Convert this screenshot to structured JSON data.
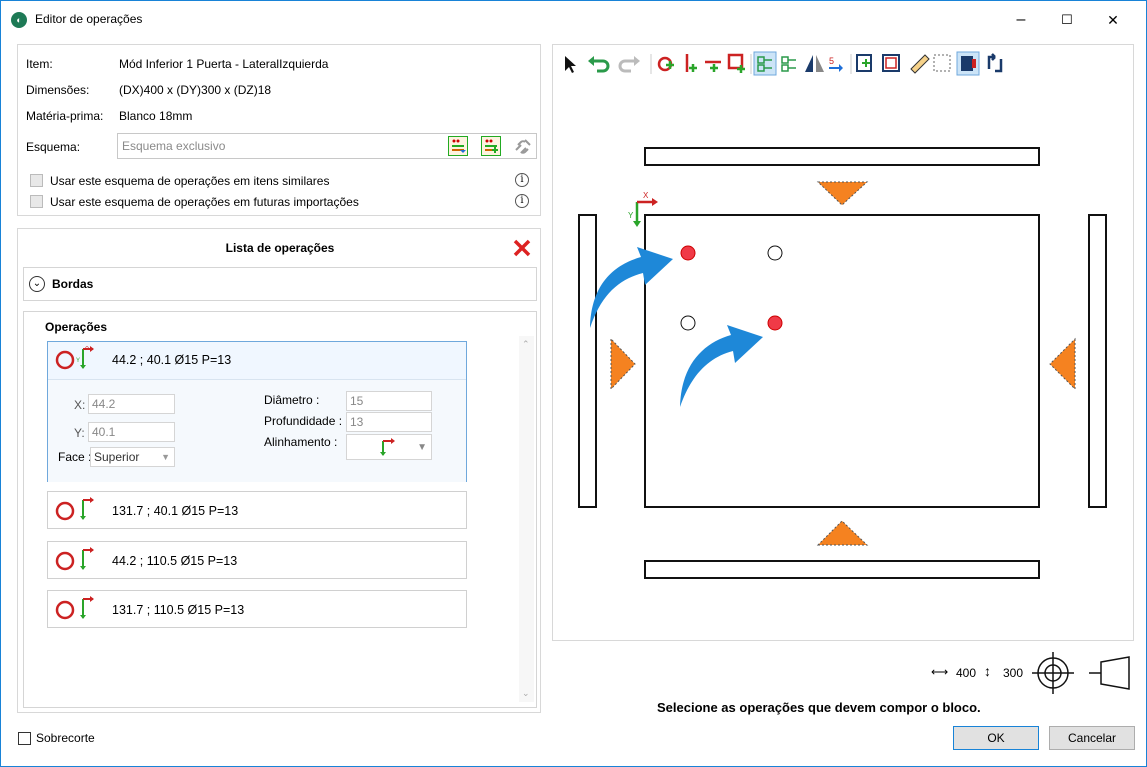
{
  "window": {
    "title": "Editor de operações",
    "minimize": "–",
    "maximize": "☐",
    "close": "✕"
  },
  "item": {
    "item_label": "Item:",
    "item_value": "Mód Inferior 1 Puerta  - LateralIzquierda",
    "dim_label": "Dimensões:",
    "dim_value": "(DX)400 x (DY)300 x (DZ)18",
    "mat_label": "Matéria-prima:",
    "mat_value": "Blanco 18mm",
    "esq_label": "Esquema:",
    "esq_placeholder": "Esquema exclusivo",
    "check1": "Usar este esquema de operações em itens similares",
    "check2": "Usar este esquema de operações em futuras importações"
  },
  "ops": {
    "header": "Lista de operações",
    "bordas": "Bordas",
    "operacoes": "Operações",
    "items": [
      {
        "text": "44.2 ; 40.1 Ø15 P=13"
      },
      {
        "text": "131.7 ; 40.1 Ø15 P=13"
      },
      {
        "text": "44.2 ; 110.5 Ø15 P=13"
      },
      {
        "text": "131.7 ; 110.5 Ø15 P=13"
      }
    ],
    "detail": {
      "x_label": "X:",
      "x_value": "44.2",
      "y_label": "Y:",
      "y_value": "40.1",
      "face_label": "Face :",
      "face_value": "Superior",
      "diam_label": "Diâmetro :",
      "diam_value": "15",
      "prof_label": "Profundidade :",
      "prof_value": "13",
      "align_label": "Alinhamento :"
    }
  },
  "footer": {
    "sobrecorte": "Sobrecorte",
    "dim_w": "400",
    "dim_h": "300",
    "message": "Selecione as operações que devem compor o bloco.",
    "ok": "OK",
    "cancel": "Cancelar"
  },
  "colors": {
    "accent": "#1883d7",
    "red": "#cc2222",
    "orange": "#f58220",
    "green": "#2aa52a",
    "blue_arrow": "#1e88d8"
  }
}
